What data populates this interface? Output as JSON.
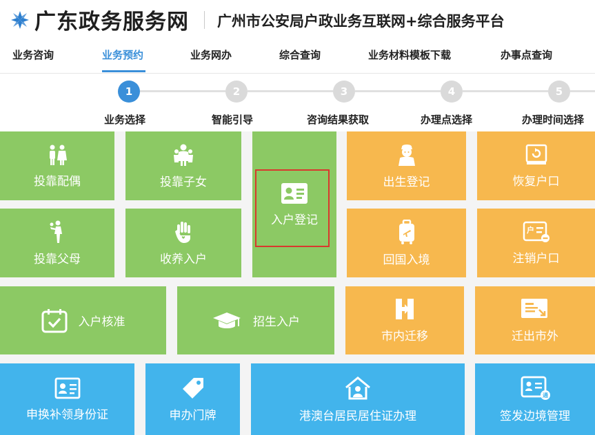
{
  "header": {
    "site_title": "广东政务服务网",
    "platform_title": "广州市公安局户政业务互联网+综合服务平台"
  },
  "nav": {
    "items": [
      {
        "label": "业务咨询",
        "active": false
      },
      {
        "label": "业务预约",
        "active": true
      },
      {
        "label": "业务网办",
        "active": false
      },
      {
        "label": "综合查询",
        "active": false
      },
      {
        "label": "业务材料模板下载",
        "active": false
      },
      {
        "label": "办事点查询",
        "active": false
      }
    ]
  },
  "steps": [
    {
      "num": "1",
      "label": "业务选择",
      "active": true
    },
    {
      "num": "2",
      "label": "智能引导",
      "active": false
    },
    {
      "num": "3",
      "label": "咨询结果获取",
      "active": false
    },
    {
      "num": "4",
      "label": "办理点选择",
      "active": false
    },
    {
      "num": "5",
      "label": "办理时间选择",
      "active": false
    }
  ],
  "tiles": {
    "tb_spouse": {
      "label": "投靠配偶",
      "icon": "couple-icon"
    },
    "tb_children": {
      "label": "投靠子女",
      "icon": "family-icon"
    },
    "register": {
      "label": "入户登记",
      "icon": "id-card-icon"
    },
    "birth": {
      "label": "出生登记",
      "icon": "baby-icon"
    },
    "restore": {
      "label": "恢复户口",
      "icon": "restore-icon"
    },
    "tb_parents": {
      "label": "投靠父母",
      "icon": "parent-child-icon"
    },
    "adopt": {
      "label": "收养入户",
      "icon": "hand-heart-icon"
    },
    "return": {
      "label": "回国入境",
      "icon": "luggage-icon"
    },
    "cancel": {
      "label": "注销户口",
      "icon": "household-cancel-icon"
    },
    "approve": {
      "label": "入户核准",
      "icon": "calendar-check-icon"
    },
    "enroll": {
      "label": "招生入户",
      "icon": "graduation-cap-icon"
    },
    "move_in_city": {
      "label": "市内迁移",
      "icon": "move-door-icon"
    },
    "move_out": {
      "label": "迁出市外",
      "icon": "move-out-icon"
    },
    "id_card": {
      "label": "申换补领身份证",
      "icon": "id-card-icon"
    },
    "door_plate": {
      "label": "申办门牌",
      "icon": "tag-icon"
    },
    "hk_permit": {
      "label": "港澳台居民居住证办理",
      "icon": "house-person-icon"
    },
    "border": {
      "label": "签发边境管理",
      "icon": "border-card-icon"
    }
  },
  "colors": {
    "accent": "#3a8fd9",
    "green": "#8cc964",
    "orange": "#f7b84e",
    "blue": "#42b4ec",
    "highlight": "#d9382e"
  }
}
